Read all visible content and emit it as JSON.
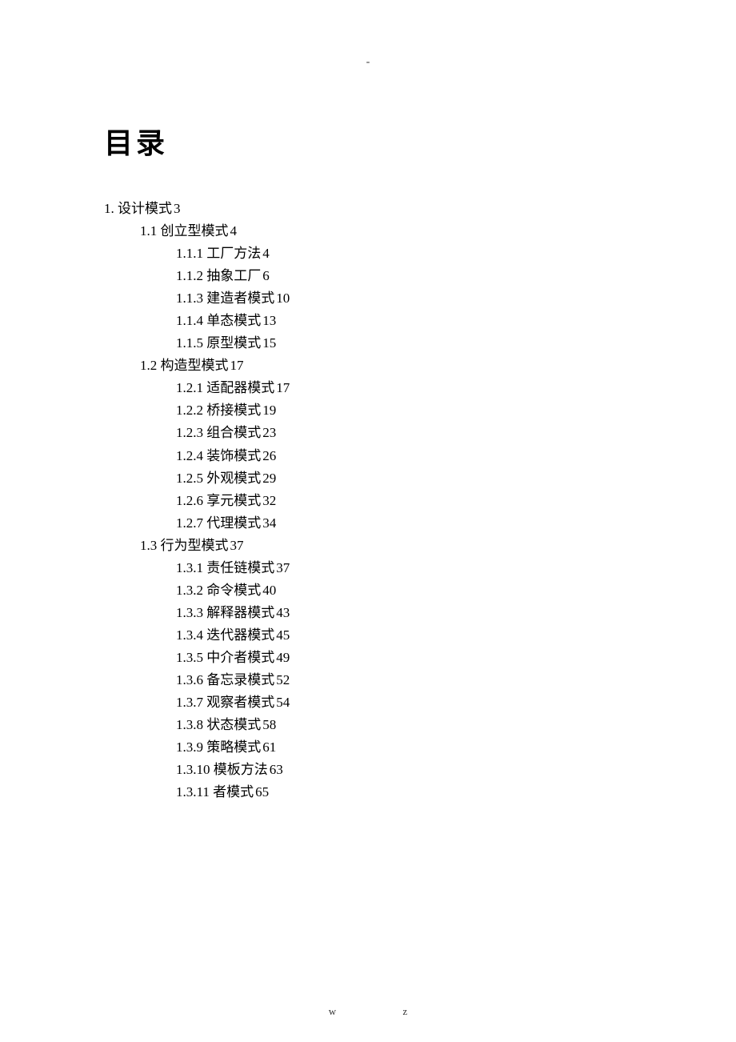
{
  "header_mark": "-",
  "title": "目录",
  "toc": {
    "l1": {
      "num": "1.",
      "text": "设计模式",
      "page": "3"
    },
    "l2_1": {
      "num": "1.1",
      "text": "创立型模式",
      "page": "4"
    },
    "l3_1_1": {
      "num": "1.1.1",
      "text": "工厂方法",
      "page": "4"
    },
    "l3_1_2": {
      "num": "1.1.2",
      "text": "抽象工厂",
      "page": "6"
    },
    "l3_1_3": {
      "num": "1.1.3",
      "text": "建造者模式",
      "page": "10"
    },
    "l3_1_4": {
      "num": "1.1.4",
      "text": "单态模式",
      "page": "13"
    },
    "l3_1_5": {
      "num": "1.1.5",
      "text": "原型模式",
      "page": "15"
    },
    "l2_2": {
      "num": "1.2",
      "text": "构造型模式",
      "page": "17"
    },
    "l3_2_1": {
      "num": "1.2.1",
      "text": "适配器模式",
      "page": "17"
    },
    "l3_2_2": {
      "num": "1.2.2",
      "text": "桥接模式",
      "page": "19"
    },
    "l3_2_3": {
      "num": "1.2.3",
      "text": "组合模式",
      "page": "23"
    },
    "l3_2_4": {
      "num": "1.2.4",
      "text": "装饰模式",
      "page": "26"
    },
    "l3_2_5": {
      "num": "1.2.5",
      "text": "外观模式",
      "page": "29"
    },
    "l3_2_6": {
      "num": "1.2.6",
      "text": "享元模式",
      "page": "32"
    },
    "l3_2_7": {
      "num": "1.2.7",
      "text": "代理模式",
      "page": "34"
    },
    "l2_3": {
      "num": "1.3",
      "text": "行为型模式",
      "page": "37"
    },
    "l3_3_1": {
      "num": "1.3.1",
      "text": "责任链模式",
      "page": "37"
    },
    "l3_3_2": {
      "num": "1.3.2",
      "text": "命令模式",
      "page": "40"
    },
    "l3_3_3": {
      "num": "1.3.3",
      "text": "解释器模式",
      "page": "43"
    },
    "l3_3_4": {
      "num": "1.3.4",
      "text": "迭代器模式",
      "page": "45"
    },
    "l3_3_5": {
      "num": "1.3.5",
      "text": "中介者模式",
      "page": "49"
    },
    "l3_3_6": {
      "num": "1.3.6",
      "text": "备忘录模式",
      "page": "52"
    },
    "l3_3_7": {
      "num": "1.3.7",
      "text": "观察者模式",
      "page": "54"
    },
    "l3_3_8": {
      "num": "1.3.8",
      "text": "状态模式",
      "page": "58"
    },
    "l3_3_9": {
      "num": "1.3.9",
      "text": "策略模式",
      "page": "61"
    },
    "l3_3_10": {
      "num": "1.3.10",
      "text": "模板方法",
      "page": "63"
    },
    "l3_3_11": {
      "num": "1.3.11",
      "text": "者模式",
      "page": "65"
    }
  },
  "footer": {
    "left": "w",
    "right": "z"
  }
}
